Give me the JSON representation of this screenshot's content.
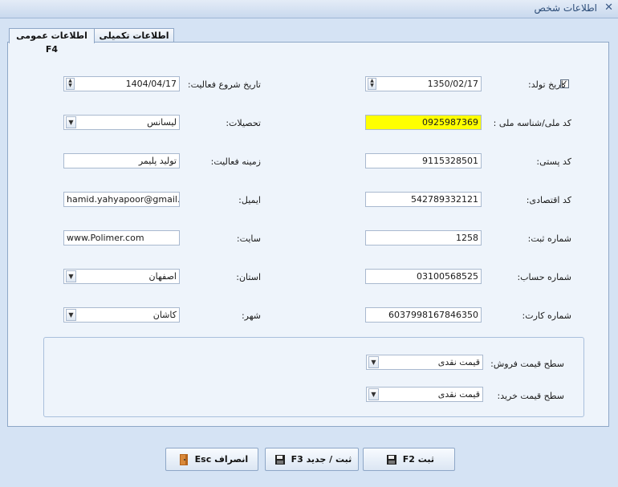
{
  "window": {
    "title": "اطلاعات شخص"
  },
  "tabs": [
    {
      "label": "اطلاعات عمومی F4"
    },
    {
      "label": "اطلاعات تکمیلی F5"
    }
  ],
  "right": {
    "birth_date": {
      "label": "تاریخ تولد:",
      "value": "1350/02/17",
      "checked": true
    },
    "national_code": {
      "label": "کد ملی/شناسه ملی :",
      "value": "0925987369",
      "highlight": "#ffff00"
    },
    "postal_code": {
      "label": "کد پستی:",
      "value": "9115328501"
    },
    "economic_code": {
      "label": "کد اقتصادی:",
      "value": "542789332121"
    },
    "registration_no": {
      "label": "شماره ثبت:",
      "value": "1258"
    },
    "account_no": {
      "label": "شماره حساب:",
      "value": "03100568525"
    },
    "card_no": {
      "label": "شماره کارت:",
      "value": "6037998167846350"
    }
  },
  "left": {
    "start_date": {
      "label": "تاریخ شروع فعالیت:",
      "value": "1404/04/17"
    },
    "education": {
      "label": "تحصیلات:",
      "value": "لیسانس"
    },
    "activity_field": {
      "label": "زمینه فعالیت:",
      "value": "تولید پلیمر"
    },
    "email": {
      "label": "ایمیل:",
      "value": "hamid.yahyapoor@gmail.com"
    },
    "website": {
      "label": "سایت:",
      "value": "www.Polimer.com"
    },
    "province": {
      "label": "استان:",
      "value": "اصفهان"
    },
    "city": {
      "label": "شهر:",
      "value": "کاشان"
    }
  },
  "pricing": {
    "sale_level": {
      "label": "سطح قیمت فروش:",
      "value": "قیمت نقدی"
    },
    "purchase_level": {
      "label": "سطح قیمت خرید:",
      "value": "قیمت نقدی"
    }
  },
  "buttons": {
    "save": "ثبت F2",
    "save_new": "ثبت / جدید F3",
    "cancel": "انصراف Esc"
  },
  "icons": {
    "close": "close-icon",
    "save": "floppy-disk-icon",
    "save_new": "floppy-disk-icon",
    "cancel": "door-exit-icon"
  }
}
